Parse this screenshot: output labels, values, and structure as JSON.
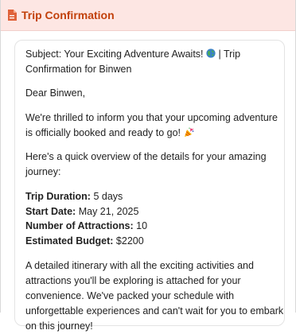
{
  "header": {
    "title": "Trip Confirmation",
    "icon": "document-icon",
    "accent_color": "#c2410c",
    "background_color": "#fde6e3"
  },
  "email": {
    "subject_before_icon": "Subject: Your Exciting Adventure Awaits!",
    "subject_icon": "globe-icon",
    "subject_after_icon": "| Trip Confirmation for Binwen",
    "greeting": "Dear Binwen,",
    "intro": "We're thrilled to inform you that your upcoming adventure is officially booked and ready to go!",
    "intro_icon": "party-popper-icon",
    "overview": "Here's a quick overview of the details for your amazing journey:",
    "details": [
      {
        "label": "Trip Duration:",
        "value": "5 days"
      },
      {
        "label": "Start Date:",
        "value": "May 21, 2025"
      },
      {
        "label": "Number of Attractions:",
        "value": "10"
      },
      {
        "label": "Estimated Budget:",
        "value": "$2200"
      }
    ],
    "itinerary_note": "A detailed itinerary with all the exciting activities and attractions you'll be exploring is attached for your convenience. We've packed your schedule with unforgettable experiences and can't wait for you to embark on this journey!"
  }
}
